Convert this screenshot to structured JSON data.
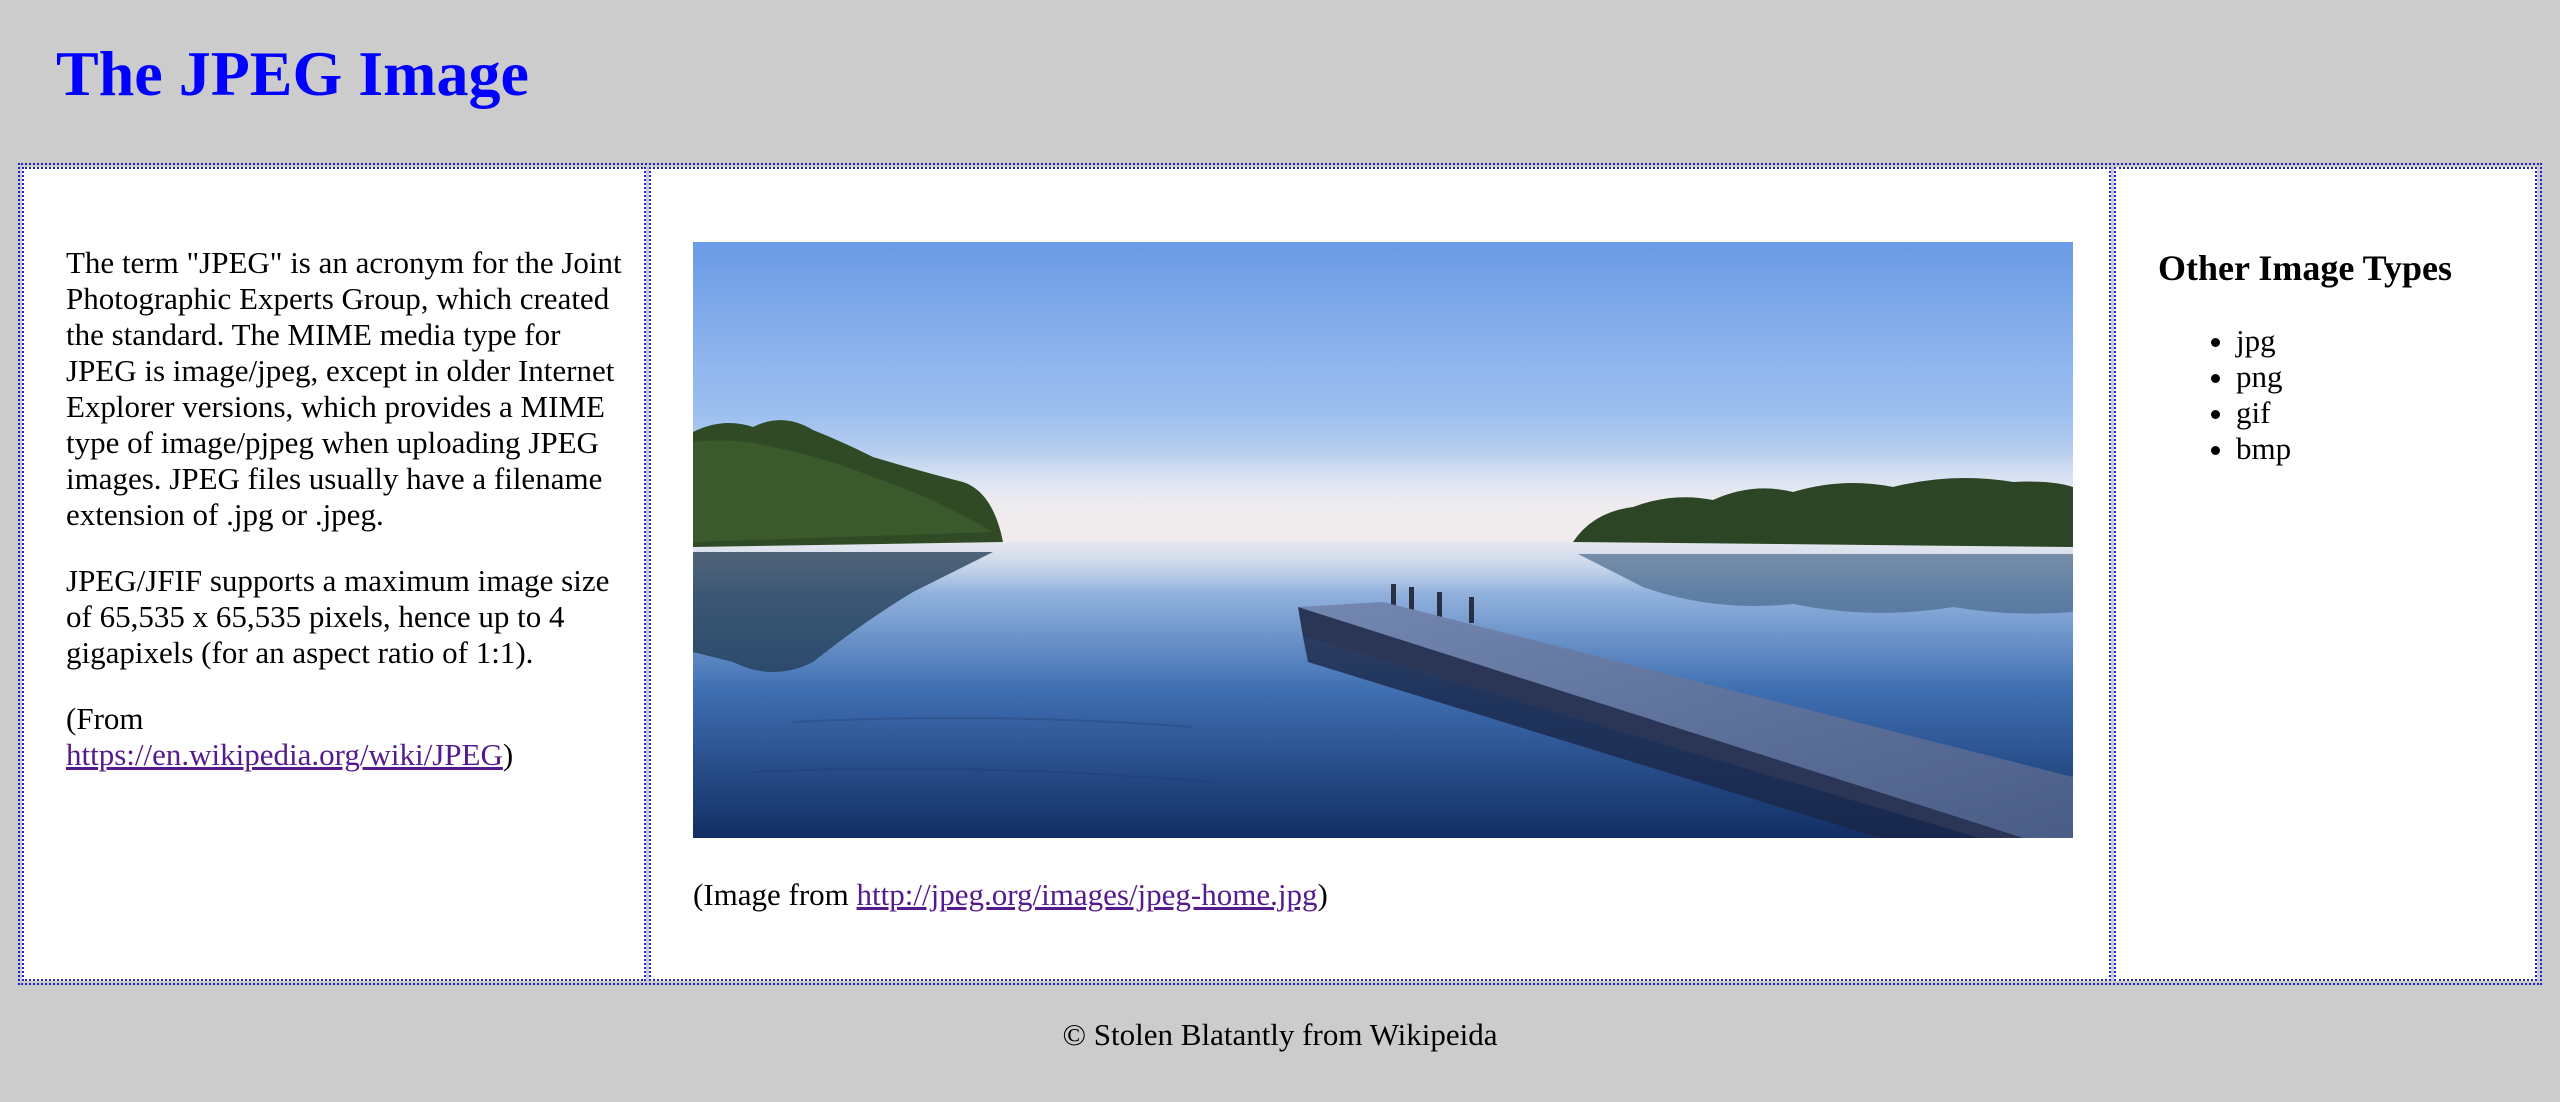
{
  "page": {
    "title": "The JPEG Image",
    "title_color": "#0000ff",
    "background_color": "#cccccc",
    "border_color": "#1e1ee0",
    "link_color": "#551a8b"
  },
  "left": {
    "paragraph1": "The term \"JPEG\" is an acronym for the Joint Photographic Experts Group, which created the standard. The MIME media type for JPEG is image/jpeg, except in older Internet Explorer versions, which provides a MIME type of image/pjpeg when uploading JPEG images. JPEG files usually have a filename extension of .jpg or .jpeg.",
    "paragraph2": "JPEG/JFIF supports a maximum image size of 65,535 x 65,535 pixels, hence up to 4 gigapixels (for an aspect ratio of 1:1).",
    "source_prefix": "(From",
    "source_link": "https://en.wikipedia.org/wiki/JPEG",
    "source_suffix": ")"
  },
  "middle": {
    "image_icon": "lake-dock-photo",
    "caption_prefix": "(Image from ",
    "caption_link": "http://jpeg.org/images/jpeg-home.jpg",
    "caption_suffix": ")"
  },
  "right": {
    "heading": "Other Image Types",
    "types": [
      "jpg",
      "png",
      "gif",
      "bmp"
    ]
  },
  "footer": {
    "text": "© Stolen Blatantly from Wikipeida"
  }
}
